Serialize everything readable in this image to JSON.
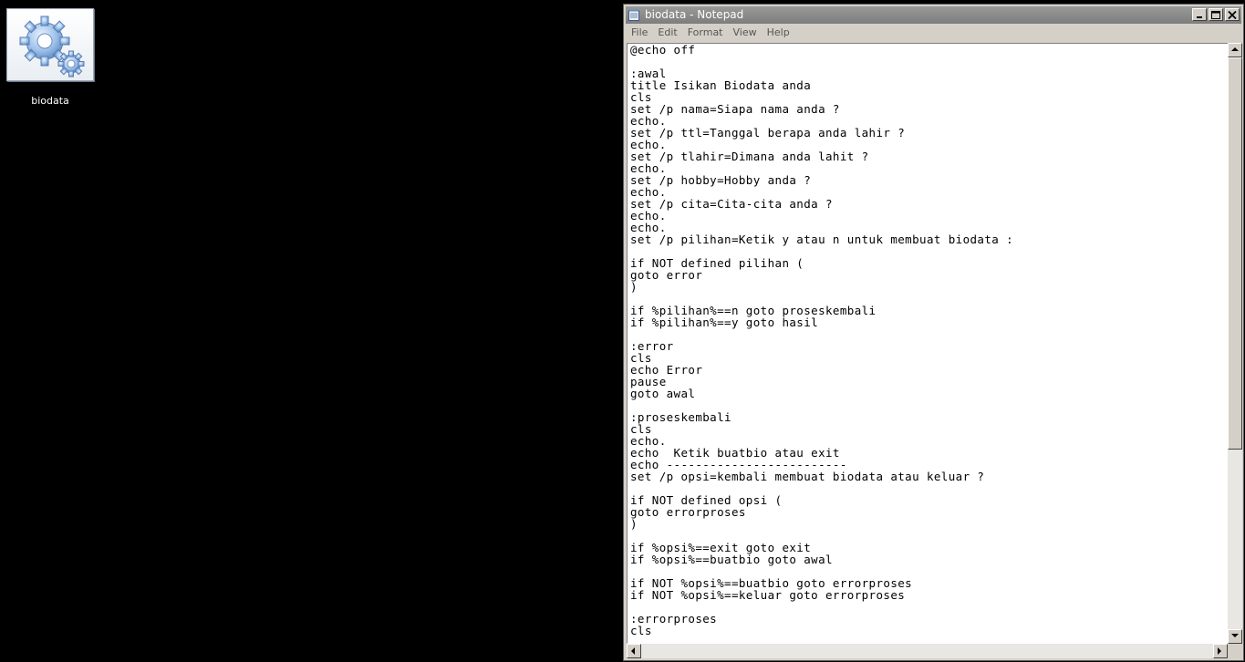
{
  "desktop": {
    "icon": {
      "label": "biodata",
      "icon_name": "gears-icon"
    }
  },
  "window": {
    "title": "biodata - Notepad",
    "menu": [
      "File",
      "Edit",
      "Format",
      "View",
      "Help"
    ],
    "content": "@echo off\n\n:awal\ntitle Isikan Biodata anda\ncls\nset /p nama=Siapa nama anda ?\necho.\nset /p ttl=Tanggal berapa anda lahir ?\necho.\nset /p tlahir=Dimana anda lahit ?\necho.\nset /p hobby=Hobby anda ?\necho.\nset /p cita=Cita-cita anda ?\necho.\necho.\nset /p pilihan=Ketik y atau n untuk membuat biodata :\n\nif NOT defined pilihan (\ngoto error\n)\n\nif %pilihan%==n goto proseskembali\nif %pilihan%==y goto hasil\n\n:error\ncls\necho Error\npause\ngoto awal\n\n:proseskembali\ncls\necho.\necho  Ketik buatbio atau exit\necho -------------------------\nset /p opsi=kembali membuat biodata atau keluar ?\n\nif NOT defined opsi (\ngoto errorproses\n)\n\nif %opsi%==exit goto exit\nif %opsi%==buatbio goto awal\n\nif NOT %opsi%==buatbio goto errorproses\nif NOT %opsi%==keluar goto errorproses\n\n:errorproses\ncls"
  },
  "colors": {
    "desktop_bg": "#000000",
    "titlebar": "#8a8a8a",
    "window_face": "#d4d0c8"
  }
}
